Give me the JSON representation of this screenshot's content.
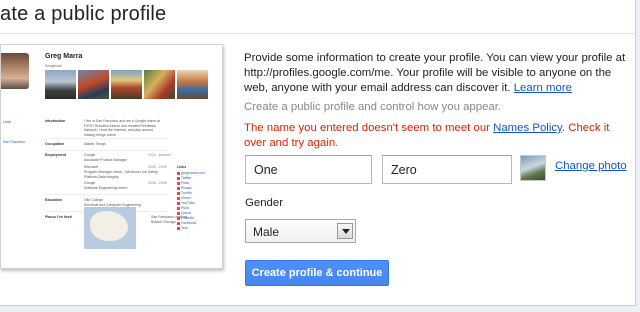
{
  "page": {
    "title": "ate a public profile"
  },
  "preview": {
    "name": "Greg Marra",
    "scrapbook_label": "Scrapbook",
    "left_links": [
      "Links",
      "San Francisco"
    ],
    "rows": [
      {
        "label": "Introduction",
        "text": "I live in San Francisco and am a Google Intern at FIRST Robotics Alumni and created Feedback Network, I love the Internet, and play around making things online"
      },
      {
        "label": "Occupation",
        "text": "Makes Things"
      },
      {
        "label": "Employment",
        "entries": [
          {
            "org": "Google",
            "role": "Associate Product Manager",
            "years": "2010 - present"
          },
          {
            "org": "Microsoft",
            "role": "Program Manager Intern - Windows Live Safety Platform Data Integrity",
            "years": "2009 - 2009"
          },
          {
            "org": "Google",
            "role": "Software Engineering Intern",
            "years": "2008 - 2008"
          }
        ]
      },
      {
        "label": "Education",
        "text": "Olin College",
        "sub": "Electrical and Computer Engineering"
      },
      {
        "label": "Places I've lived",
        "text": "San Francisco Hartford Boston Chicago"
      }
    ],
    "links_heading": "Links",
    "links": [
      "gregmarra.com",
      "Twitter",
      "Flickr",
      "Picasa",
      "Tumblr",
      "Vimeo",
      "YouTube",
      "Plurk",
      "Quora",
      "LinkedIn",
      "Facebook",
      "Yelp"
    ]
  },
  "intro": {
    "text": "Provide some information to create your profile. You can view your profile at http://profiles.google.com/me. Your profile will be visible to anyone on the web, anyone with your email address can discover it.",
    "learn_more": "Learn more"
  },
  "control_text": "Create a public profile and control how you appear.",
  "error": {
    "before": "The name you entered doesn't seem to meet our ",
    "link": "Names Policy",
    "after": ". Check it over and try again."
  },
  "form": {
    "first_name": "One",
    "last_name": "Zero",
    "change_photo": "Change photo",
    "gender_label": "Gender",
    "gender_value": "Male",
    "submit": "Create profile & continue"
  },
  "colors": {
    "error": "#dd2200",
    "link": "#1155cc",
    "button": "#4d90fe"
  }
}
